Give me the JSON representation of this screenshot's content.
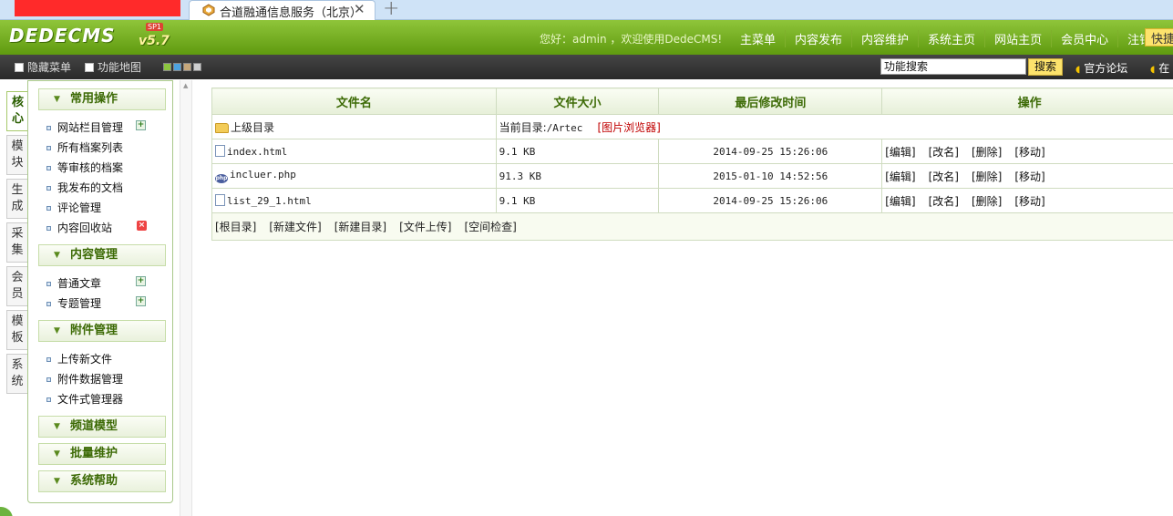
{
  "browser": {
    "tab_title": "合道融通信息服务（北京）",
    "close_glyph": "✕",
    "newtab_glyph": "+"
  },
  "header": {
    "logo": "DEDECMS",
    "version": "v5.7",
    "sp": "SP1",
    "welcome": "您好：admin ，欢迎使用DedeCMS!",
    "nav": [
      "主菜单",
      "内容发布",
      "内容维护",
      "系统主页",
      "网站主页",
      "会员中心",
      "注销"
    ],
    "quick": "快捷"
  },
  "toolbar": {
    "hide_menu": "隐藏菜单",
    "site_map": "功能地图",
    "search_value": "功能搜索",
    "search_btn": "搜索",
    "official_forum": "官方论坛",
    "right_cut": "在"
  },
  "vtabs": [
    {
      "label": "核心"
    },
    {
      "label": "模块"
    },
    {
      "label": "生成"
    },
    {
      "label": "采集"
    },
    {
      "label": "会员"
    },
    {
      "label": "模板"
    },
    {
      "label": "系统"
    }
  ],
  "menu": {
    "common": {
      "title": "常用操作",
      "items": [
        "网站栏目管理",
        "所有档案列表",
        "等审核的档案",
        "我发布的文档",
        "评论管理",
        "内容回收站"
      ]
    },
    "content": {
      "title": "内容管理",
      "items": [
        "普通文章",
        "专题管理"
      ]
    },
    "attach": {
      "title": "附件管理",
      "items": [
        "上传新文件",
        "附件数据管理",
        "文件式管理器"
      ]
    },
    "channel": {
      "title": "频道模型"
    },
    "batch": {
      "title": "批量维护"
    },
    "help": {
      "title": "系统帮助"
    }
  },
  "table": {
    "headers": [
      "文件名",
      "文件大小",
      "最后修改时间",
      "操作"
    ],
    "parent_dir": "上级目录",
    "current_dir_label": "当前目录:",
    "current_dir_path": "/Artec",
    "image_browser": "[图片浏览器]",
    "actions": [
      "[编辑]",
      "[改名]",
      "[删除]",
      "[移动]"
    ],
    "rows": [
      {
        "name": "index.html",
        "size": "9.1 KB",
        "mtime": "2014-09-25 15:26:06",
        "icon": "html-file-icon"
      },
      {
        "name": "incluer.php",
        "size": "91.3 KB",
        "mtime": "2015-01-10 14:52:56",
        "icon": "php-file-icon"
      },
      {
        "name": "list_29_1.html",
        "size": "9.1 KB",
        "mtime": "2014-09-25 15:26:06",
        "icon": "html-file-icon"
      }
    ],
    "footer_links": [
      "[根目录]",
      "[新建文件]",
      "[新建目录]",
      "[文件上传]",
      "[空间检查]"
    ]
  },
  "colors": {
    "header_green": "#6fad1f",
    "toolbar_dark": "#333333",
    "accent_red": "#c00000",
    "quick_yellow": "#fde36c"
  }
}
